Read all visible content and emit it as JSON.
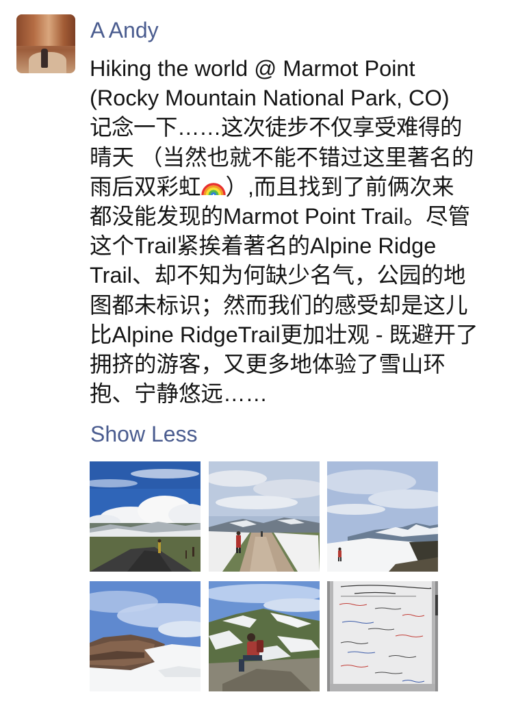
{
  "post": {
    "author": "A Andy",
    "body_lines": [
      "Hiking the world @ Marmot Point",
      "(Rocky Mountain National Park, CO)",
      "记念一下……这次徒步不仅享受难得的",
      "晴天 （当然也就不能不错过这里著名的",
      "雨后双彩虹",
      "）,而且找到了前俩次来",
      "都没能发现的Marmot Point Trail。尽管",
      "这个Trail紧挨着著名的Alpine Ridge",
      "Trail、却不知为何缺少名气，公园的地",
      "图都未标识；然而我们的感受却是这儿",
      "比Alpine RidgeTrail更加壮观 - 既避开了",
      "拥挤的游客，又更多地体验了雪山环",
      "抱、宁静悠远……"
    ],
    "emoji": "rainbow-icon",
    "show_less_label": "Show Less"
  },
  "photos": [
    {
      "name": "photo-alpine-road-clouds"
    },
    {
      "name": "photo-hikers-on-trail"
    },
    {
      "name": "photo-snowfield-hiker"
    },
    {
      "name": "photo-rock-cliff-snow"
    },
    {
      "name": "photo-hiker-sitting-rocks"
    },
    {
      "name": "photo-whiteboard-notes"
    }
  ],
  "colors": {
    "link": "#4a5c8f",
    "text": "#141414",
    "background": "#ffffff"
  }
}
